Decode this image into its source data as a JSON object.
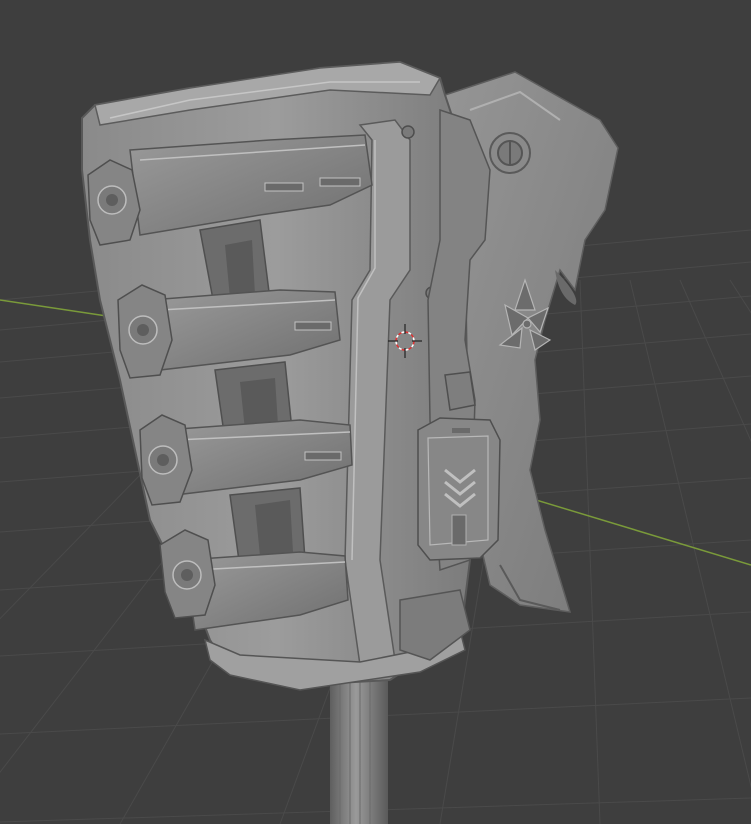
{
  "app": "3D Viewport",
  "viewport": {
    "background_color": "#3e3e3e",
    "grid_color": "#4a4a4a",
    "x_axis_color": "#7a9a3a",
    "model_base_color": "#8f8f8f",
    "model_highlight_color": "#b8b8b8",
    "model_shadow_color": "#5e5e5e",
    "cursor_color": "#e03030"
  },
  "icons": {
    "cursor": "3d-cursor-icon",
    "emblem": "tri-blade-emblem-icon",
    "chevrons": "chevron-stack-icon"
  }
}
